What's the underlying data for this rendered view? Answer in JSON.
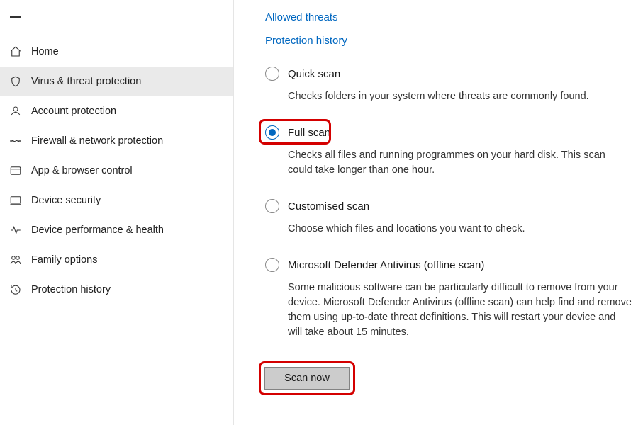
{
  "links": {
    "allowed_threats": "Allowed threats",
    "protection_history": "Protection history"
  },
  "sidebar": {
    "items": [
      {
        "id": "home",
        "label": "Home"
      },
      {
        "id": "virus-threat",
        "label": "Virus & threat protection"
      },
      {
        "id": "account",
        "label": "Account protection"
      },
      {
        "id": "firewall",
        "label": "Firewall & network protection"
      },
      {
        "id": "app-browser",
        "label": "App & browser control"
      },
      {
        "id": "device-security",
        "label": "Device security"
      },
      {
        "id": "device-perf",
        "label": "Device performance & health"
      },
      {
        "id": "family",
        "label": "Family options"
      },
      {
        "id": "protection-history",
        "label": "Protection history"
      }
    ],
    "selected": "virus-threat"
  },
  "scan_options": [
    {
      "id": "quick",
      "label": "Quick scan",
      "desc": "Checks folders in your system where threats are commonly found.",
      "checked": false,
      "highlight": false
    },
    {
      "id": "full",
      "label": "Full scan",
      "desc": "Checks all files and running programmes on your hard disk. This scan could take longer than one hour.",
      "checked": true,
      "highlight": true
    },
    {
      "id": "custom",
      "label": "Customised scan",
      "desc": "Choose which files and locations you want to check.",
      "checked": false,
      "highlight": false
    },
    {
      "id": "offline",
      "label": "Microsoft Defender Antivirus (offline scan)",
      "desc": "Some malicious software can be particularly difficult to remove from your device. Microsoft Defender Antivirus (offline scan) can help find and remove them using up-to-date threat definitions. This will restart your device and will take about 15 minutes.",
      "checked": false,
      "highlight": false
    }
  ],
  "scan_button": {
    "label": "Scan now",
    "highlight": true
  }
}
